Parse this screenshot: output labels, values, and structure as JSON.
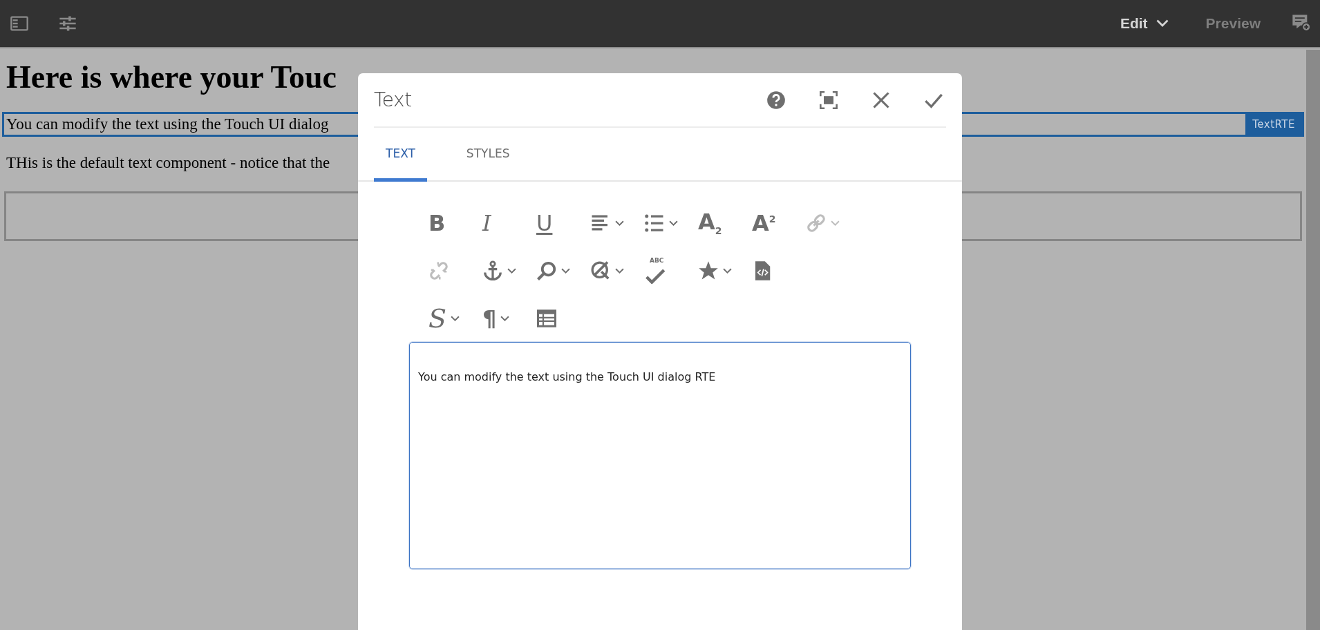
{
  "top_bar": {
    "left_tools": [
      {
        "kind": "side-panel"
      },
      {
        "kind": "sliders"
      }
    ],
    "modes": [
      {
        "label": "Edit",
        "selected": true,
        "dropdown": true
      },
      {
        "label": "Preview",
        "selected": false,
        "dropdown": false
      }
    ],
    "right_tools": [
      {
        "kind": "annotate"
      }
    ]
  },
  "page": {
    "heading": "Here is where your Touc",
    "components": [
      {
        "kind": "text",
        "text": "You can modify the text using the Touch UI dialog",
        "selected": true,
        "badge": "TextRTE"
      },
      {
        "kind": "text",
        "text": "THis is the default text component - notice that the",
        "selected": false
      },
      {
        "kind": "placeholder",
        "selected": false
      }
    ]
  },
  "dialog": {
    "title": "Text",
    "actions": [
      {
        "kind": "help"
      },
      {
        "kind": "fullscreen"
      },
      {
        "kind": "close"
      },
      {
        "kind": "done"
      }
    ],
    "tabs": [
      {
        "label": "TEXT",
        "selected": true
      },
      {
        "label": "STYLES",
        "selected": false
      }
    ],
    "toolbar_rows": [
      {
        "buttons": [
          {
            "kind": "bold",
            "glyph": "B",
            "dropdown": false,
            "disabled": false
          },
          {
            "kind": "italic",
            "glyph": "I",
            "dropdown": false,
            "disabled": false
          },
          {
            "kind": "underline",
            "glyph": "U",
            "dropdown": false,
            "disabled": false
          },
          {
            "kind": "justify",
            "dropdown": true,
            "disabled": false
          },
          {
            "kind": "list",
            "dropdown": true,
            "disabled": false
          },
          {
            "kind": "subscript",
            "glyph": "A$_{2}$",
            "dropdown": false,
            "disabled": false
          },
          {
            "kind": "superscript",
            "glyph": "A$^{2}$",
            "dropdown": false,
            "disabled": false
          },
          {
            "kind": "link",
            "dropdown": true,
            "disabled": true
          }
        ]
      },
      {
        "buttons": [
          {
            "kind": "unlink",
            "dropdown": false,
            "disabled": true
          },
          {
            "kind": "anchor",
            "dropdown": true,
            "disabled": false
          },
          {
            "kind": "find",
            "dropdown": true,
            "disabled": false
          },
          {
            "kind": "no-edit",
            "dropdown": true,
            "disabled": false
          },
          {
            "kind": "spellcheck",
            "glyph": "ABC",
            "dropdown": false,
            "disabled": false
          },
          {
            "kind": "star",
            "dropdown": true,
            "disabled": false
          },
          {
            "kind": "source",
            "dropdown": false,
            "disabled": false
          }
        ]
      },
      {
        "buttons": [
          {
            "kind": "styles",
            "glyph": "S",
            "dropdown": true,
            "disabled": false
          },
          {
            "kind": "paragraph",
            "glyph": "¶",
            "dropdown": true,
            "disabled": false
          },
          {
            "kind": "table",
            "dropdown": false,
            "disabled": false
          }
        ]
      }
    ],
    "editor_text": "You can modify the text using the Touch UI dialog RTE"
  }
}
